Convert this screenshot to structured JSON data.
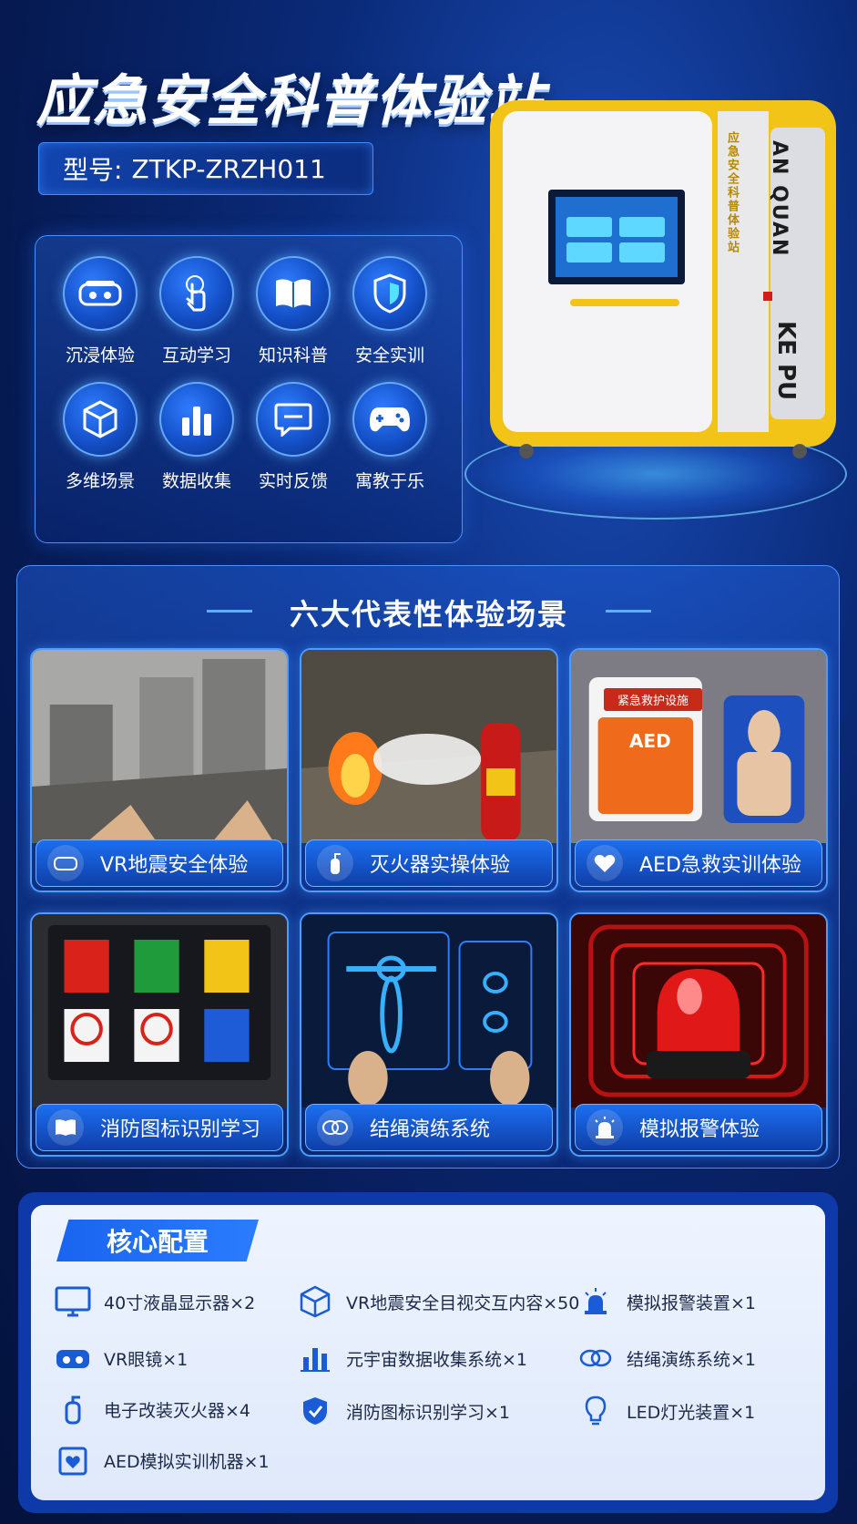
{
  "header": {
    "title": "应急安全科普体验站",
    "model_label": "型号:",
    "model_value": "ZTKP-ZRZH011"
  },
  "features": [
    {
      "label": "沉浸体验",
      "icon": "vr-headset-icon"
    },
    {
      "label": "互动学习",
      "icon": "touch-hand-icon"
    },
    {
      "label": "知识科普",
      "icon": "book-icon"
    },
    {
      "label": "安全实训",
      "icon": "shield-icon"
    },
    {
      "label": "多维场景",
      "icon": "cube-icon"
    },
    {
      "label": "数据收集",
      "icon": "bar-chart-icon"
    },
    {
      "label": "实时反馈",
      "icon": "chat-bubble-icon"
    },
    {
      "label": "寓教于乐",
      "icon": "gamepad-icon"
    }
  ],
  "machine": {
    "side_text": "AN QUAN",
    "vertical_text": "应急安全科普体验站",
    "brand": "KE PU"
  },
  "scenarios": {
    "title": "六大代表性体验场景",
    "items": [
      {
        "label": "VR地震安全体验",
        "icon": "vr-headset-icon"
      },
      {
        "label": "灭火器实操体验",
        "icon": "fire-extinguisher-icon"
      },
      {
        "label": "AED急救实训体验",
        "icon": "heart-icon"
      },
      {
        "label": "消防图标识别学习",
        "icon": "book-icon"
      },
      {
        "label": "结绳演练系统",
        "icon": "knot-icon"
      },
      {
        "label": "模拟报警体验",
        "icon": "alarm-light-icon"
      }
    ],
    "aed_panel_title": "紧急救护设施",
    "aed_text": "AED"
  },
  "core": {
    "title": "核心配置",
    "items": [
      {
        "label": "40寸液晶显示器×2",
        "icon": "monitor-icon"
      },
      {
        "label": "VR地震安全目视交互内容×50",
        "icon": "cube-icon"
      },
      {
        "label": "模拟报警装置×1",
        "icon": "alarm-light-icon"
      },
      {
        "label": "VR眼镜×1",
        "icon": "vr-headset-icon"
      },
      {
        "label": "元宇宙数据收集系统×1",
        "icon": "bar-chart-icon"
      },
      {
        "label": "结绳演练系统×1",
        "icon": "knot-icon"
      },
      {
        "label": "电子改装灭火器×4",
        "icon": "fire-extinguisher-icon"
      },
      {
        "label": "消防图标识别学习×1",
        "icon": "shield-icon"
      },
      {
        "label": "LED灯光装置×1",
        "icon": "lightbulb-icon"
      },
      {
        "label": "AED模拟实训机器×1",
        "icon": "aed-icon"
      }
    ]
  },
  "colors": {
    "accent": "#1a64f0",
    "machine_yellow": "#f2c417",
    "alarm_red": "#e01818"
  }
}
